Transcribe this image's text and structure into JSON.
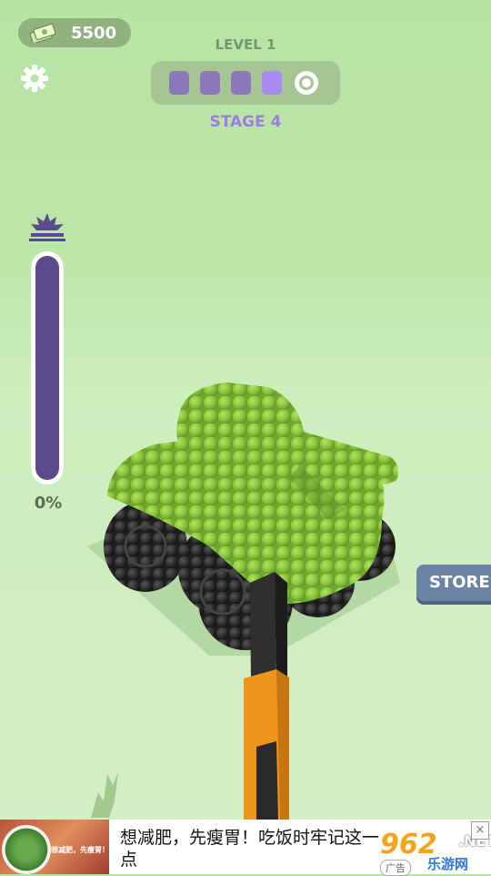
{
  "hud": {
    "cash_value": "5500",
    "level_label": "LEVEL 1",
    "stage_label": "STAGE 4",
    "stage_steps": [
      {
        "state": "done",
        "color": "#8a78b8"
      },
      {
        "state": "done",
        "color": "#8a78b8"
      },
      {
        "state": "done",
        "color": "#8a78b8"
      },
      {
        "state": "current",
        "color": "#a98af0"
      },
      {
        "state": "target",
        "color": "#ffffff"
      }
    ]
  },
  "meter": {
    "icon": "burst-icon",
    "value_label": "0%",
    "progress": 0,
    "fill_color": "#b597ff",
    "track_color": "#5b4b8d"
  },
  "store": {
    "label": "STORE"
  },
  "scene": {
    "object": "tank",
    "body_color": "#8cc63f",
    "wheel_color": "#2b2b2b",
    "tool_colors": {
      "handle": "#f0951c",
      "shaft": "#333333"
    }
  },
  "ad": {
    "text": "想减肥，先瘦胃！吃饭时牢记这一点",
    "thumb_text": "想减肥，先瘦胃！",
    "tag": "广告",
    "close_label": "×"
  },
  "watermark": {
    "number": "962",
    "suffix": ".NET",
    "sub": "乐游网"
  },
  "colors": {
    "background_top": "#b7e3a3",
    "background_bottom": "#d3efc6",
    "accent_purple": "#9b7fe0",
    "store_button": "#6b84a6"
  }
}
